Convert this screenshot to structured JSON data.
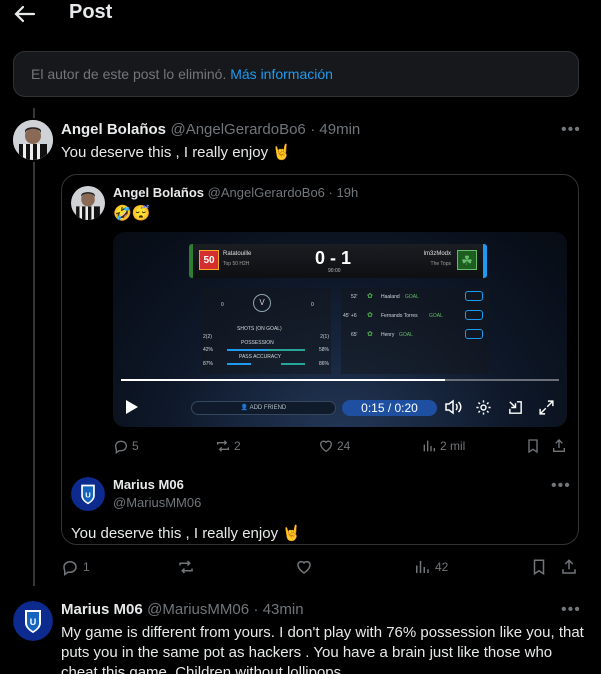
{
  "header": {
    "title": "Post"
  },
  "deleted_notice": {
    "text": "El autor de este post lo eliminó.",
    "link": "Más información"
  },
  "reply": {
    "name": "Angel Bolaños",
    "handle": "@AngelGerardoBo6",
    "time": "· 49min",
    "text": "You deserve this , I really enjoy 🤘",
    "stats": {
      "replies": "1",
      "reposts": "",
      "likes": "",
      "views": "42"
    }
  },
  "quoted": {
    "name": "Angel Bolaños",
    "handle": "@AngelGerardoBo6",
    "time": "· 19h",
    "emojis": "🤣😴",
    "video": {
      "home_score_badge": "50",
      "home_team": "Ratatouille",
      "home_sub": "Top 50 H2H",
      "score": "0 - 1",
      "match_time": "90:00",
      "away_team": "lm3zModx",
      "away_sub": "The Tops",
      "stats_label_shots": "SHOTS (ON GOAL)",
      "stats_label_possession": "POSSESSION",
      "stats_label_pass": "PASS ACCURACY",
      "shots_home": "2(2)",
      "shots_away": "2(1)",
      "poss_home": "42%",
      "poss_away": "58%",
      "pass_home": "87%",
      "pass_away": "86%",
      "goals": [
        {
          "minute": "52'",
          "player": "Haaland",
          "tag": "GOAL"
        },
        {
          "minute": "45' +6",
          "player": "Fernando Torres",
          "tag": "GOAL"
        },
        {
          "minute": "65'",
          "player": "Henry",
          "tag": "GOAL"
        }
      ],
      "add_friend": "ADD FRIEND",
      "time_display": "0:15 / 0:20",
      "progress": 0.74
    },
    "stats": {
      "replies": "5",
      "reposts": "2",
      "likes": "24",
      "views": "2 mil"
    }
  },
  "embedded_reply": {
    "name": "Marius M06",
    "handle": "@MariusMM06",
    "text": "You deserve this , I really enjoy 🤘"
  },
  "bottom_post": {
    "name": "Marius M06",
    "handle": "@MariusMM06",
    "time": "· 43min",
    "text": "My game is different from yours. I don't play with 76% possession like you, that puts you in the same pot as hackers . You have a brain just like those who cheat this game. Children without lollipops"
  },
  "colors": {
    "accent": "#1d9bf0",
    "background": "#000000",
    "muted": "#71767b",
    "border": "#2f3336"
  }
}
